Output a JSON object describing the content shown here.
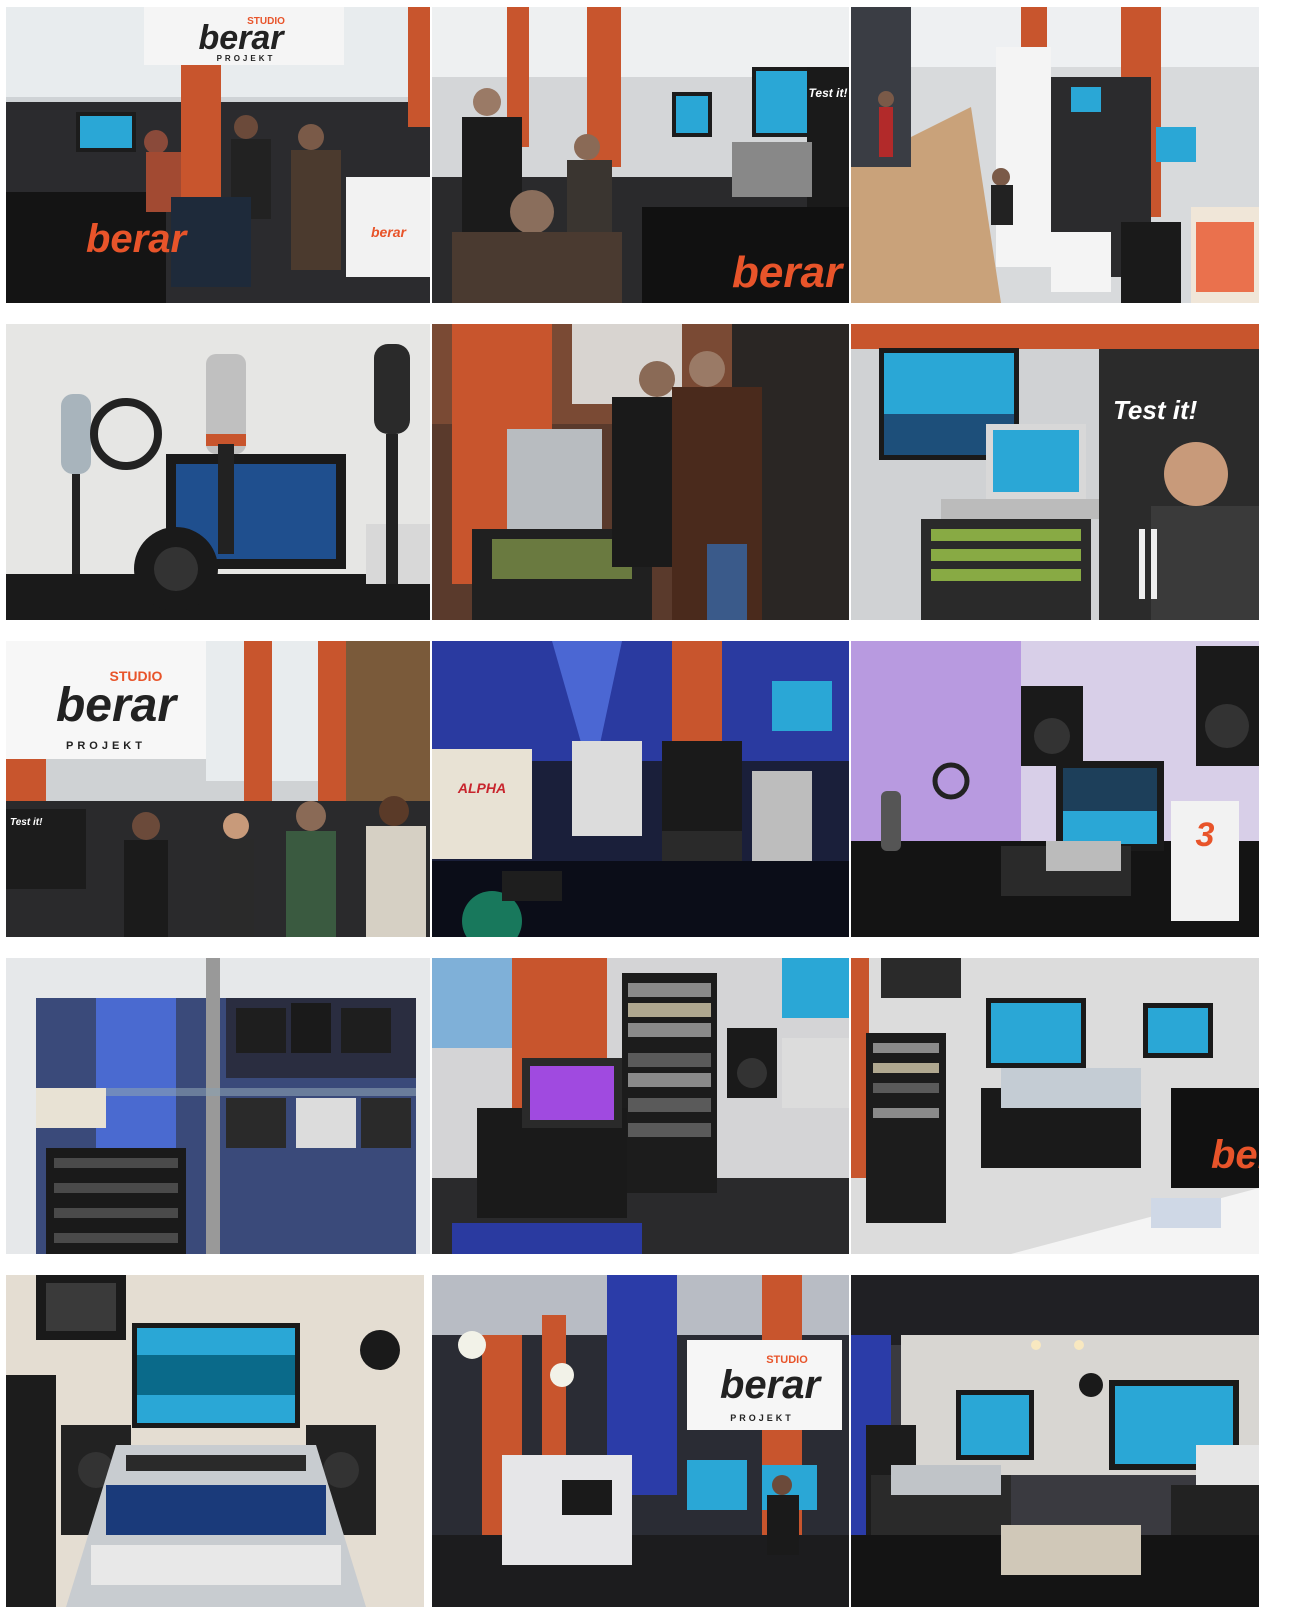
{
  "gallery": {
    "rows": 5,
    "columns": 3,
    "photos": [
      {
        "subject": "exhibition booth with sign and visitors"
      },
      {
        "subject": "visitors at mixing desk booth"
      },
      {
        "subject": "aisle of exhibition booths"
      },
      {
        "subject": "microphones and headphones on table"
      },
      {
        "subject": "two men at equipment rack"
      },
      {
        "subject": "monitor, laptop and Test it! poster"
      },
      {
        "subject": "booth sign and camera crew"
      },
      {
        "subject": "blue-lit product display"
      },
      {
        "subject": "studio monitors and audio interface"
      },
      {
        "subject": "glass display cabinet"
      },
      {
        "subject": "equipment racks and flight case"
      },
      {
        "subject": "booth with mixing console"
      },
      {
        "subject": "large digital mixing console"
      },
      {
        "subject": "hall with booths and sign"
      },
      {
        "subject": "booth with consoles and screens"
      }
    ]
  },
  "signs": {
    "studio": "STUDIO",
    "brand": "berar",
    "projekt": "PROJEKT",
    "test_it": "Test it!",
    "alpha": "ALPHA",
    "big_number": "3"
  },
  "colors": {
    "accent": "#e8542a",
    "pillar": "#c8552d",
    "screen": "#2aa7d6",
    "purple_light": "#7a3fd6"
  }
}
